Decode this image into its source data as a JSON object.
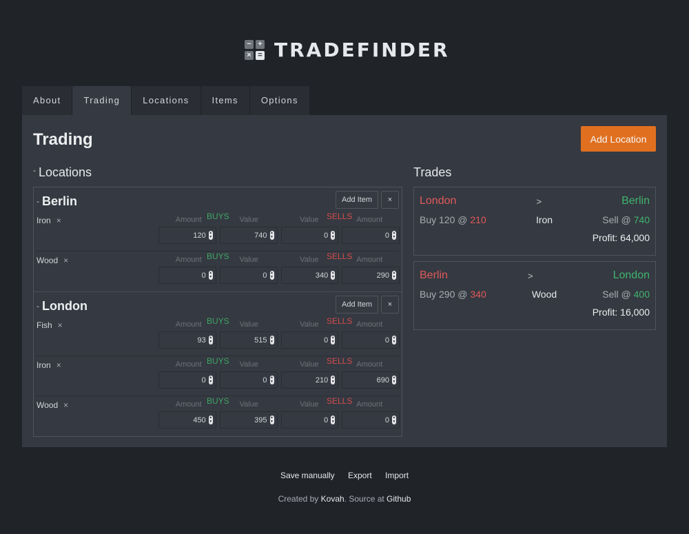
{
  "app": {
    "title": "TRADEFINDER",
    "logo_glyphs": [
      "−",
      "+",
      "×",
      "="
    ]
  },
  "tabs": [
    {
      "label": "About",
      "active": false
    },
    {
      "label": "Trading",
      "active": true
    },
    {
      "label": "Locations",
      "active": false
    },
    {
      "label": "Items",
      "active": false
    },
    {
      "label": "Options",
      "active": false
    }
  ],
  "page": {
    "title": "Trading",
    "add_location_label": "Add Location"
  },
  "locations_section": {
    "collapse_glyph": "-",
    "title": "Locations",
    "add_item_label": "Add Item",
    "remove_location_glyph": "×",
    "remove_item_glyph": "×",
    "labels": {
      "amount": "Amount",
      "buys": "BUYS",
      "value": "Value",
      "sells": "SELLS"
    },
    "locations": [
      {
        "name": "Berlin",
        "items": [
          {
            "name": "Iron",
            "buy_amount": "120",
            "buy_value": "740",
            "sell_value": "0",
            "sell_amount": "0"
          },
          {
            "name": "Wood",
            "buy_amount": "0",
            "buy_value": "0",
            "sell_value": "340",
            "sell_amount": "290"
          }
        ]
      },
      {
        "name": "London",
        "items": [
          {
            "name": "Fish",
            "buy_amount": "93",
            "buy_value": "515",
            "sell_value": "0",
            "sell_amount": "0"
          },
          {
            "name": "Iron",
            "buy_amount": "0",
            "buy_value": "0",
            "sell_value": "210",
            "sell_amount": "690"
          },
          {
            "name": "Wood",
            "buy_amount": "450",
            "buy_value": "395",
            "sell_value": "0",
            "sell_amount": "0"
          }
        ]
      }
    ]
  },
  "trades_section": {
    "title": "Trades",
    "arrow": ">",
    "trades": [
      {
        "from": "London",
        "to": "Berlin",
        "buy_prefix": "Buy 120 @ ",
        "buy_price": "210",
        "item": "Iron",
        "sell_prefix": "Sell @ ",
        "sell_price": "740",
        "profit": "Profit: 64,000"
      },
      {
        "from": "Berlin",
        "to": "London",
        "buy_prefix": "Buy 290 @ ",
        "buy_price": "340",
        "item": "Wood",
        "sell_prefix": "Sell @ ",
        "sell_price": "400",
        "profit": "Profit: 16,000"
      }
    ]
  },
  "footer": {
    "save_label": "Save manually",
    "export_label": "Export",
    "import_label": "Import",
    "credits_prefix": "Created by ",
    "author": "Kovah",
    "credits_middle": ". Source at ",
    "source": "Github"
  },
  "colors": {
    "accent": "#e07020",
    "buy": "#3fa566",
    "sell": "#d24d4d",
    "background": "#202328",
    "panel": "#353941"
  }
}
